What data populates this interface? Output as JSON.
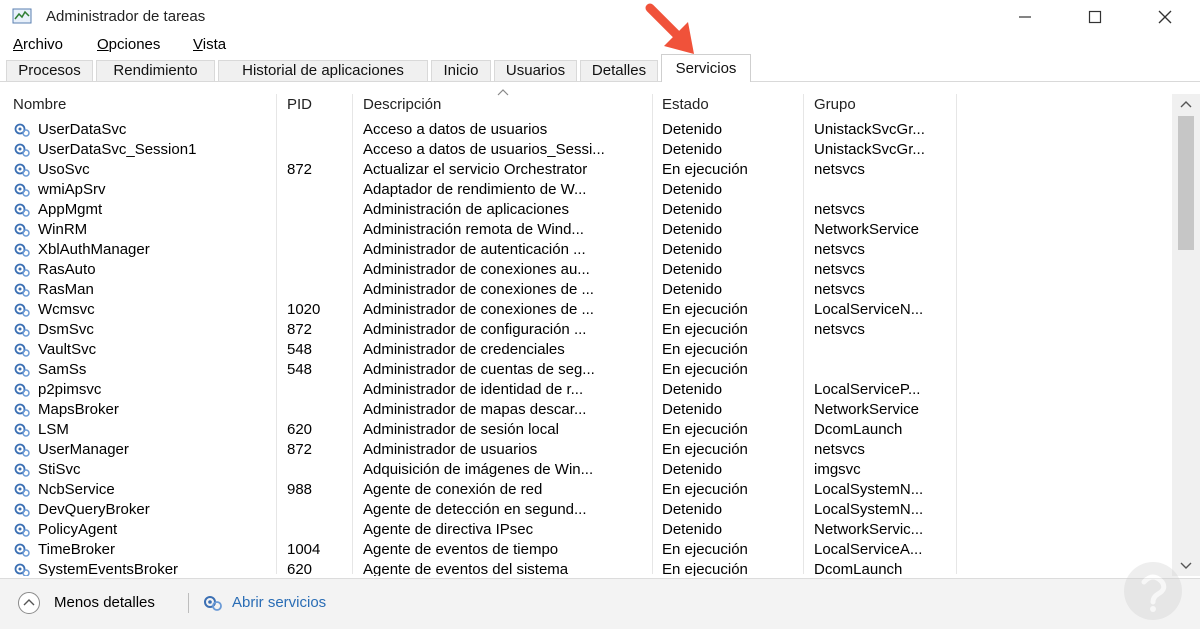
{
  "window": {
    "title": "Administrador de tareas"
  },
  "menu": {
    "archivo": "Archivo",
    "opciones": "Opciones",
    "vista": "Vista"
  },
  "tabs": [
    {
      "label": "Procesos"
    },
    {
      "label": "Rendimiento"
    },
    {
      "label": "Historial de aplicaciones"
    },
    {
      "label": "Inicio"
    },
    {
      "label": "Usuarios"
    },
    {
      "label": "Detalles"
    },
    {
      "label": "Servicios",
      "active": true
    }
  ],
  "columns": {
    "name": "Nombre",
    "pid": "PID",
    "desc": "Descripción",
    "state": "Estado",
    "group": "Grupo"
  },
  "rows": [
    {
      "name": "UserDataSvc",
      "pid": "",
      "desc": "Acceso a datos de usuarios",
      "state": "Detenido",
      "group": "UnistackSvcGr..."
    },
    {
      "name": "UserDataSvc_Session1",
      "pid": "",
      "desc": "Acceso a datos de usuarios_Sessi...",
      "state": "Detenido",
      "group": "UnistackSvcGr..."
    },
    {
      "name": "UsoSvc",
      "pid": "872",
      "desc": "Actualizar el servicio Orchestrator",
      "state": "En ejecución",
      "group": "netsvcs"
    },
    {
      "name": "wmiApSrv",
      "pid": "",
      "desc": "Adaptador de rendimiento de W...",
      "state": "Detenido",
      "group": ""
    },
    {
      "name": "AppMgmt",
      "pid": "",
      "desc": "Administración de aplicaciones",
      "state": "Detenido",
      "group": "netsvcs"
    },
    {
      "name": "WinRM",
      "pid": "",
      "desc": "Administración remota de Wind...",
      "state": "Detenido",
      "group": "NetworkService"
    },
    {
      "name": "XblAuthManager",
      "pid": "",
      "desc": "Administrador de autenticación ...",
      "state": "Detenido",
      "group": "netsvcs"
    },
    {
      "name": "RasAuto",
      "pid": "",
      "desc": "Administrador de conexiones au...",
      "state": "Detenido",
      "group": "netsvcs"
    },
    {
      "name": "RasMan",
      "pid": "",
      "desc": "Administrador de conexiones de ...",
      "state": "Detenido",
      "group": "netsvcs"
    },
    {
      "name": "Wcmsvc",
      "pid": "1020",
      "desc": "Administrador de conexiones de ...",
      "state": "En ejecución",
      "group": "LocalServiceN..."
    },
    {
      "name": "DsmSvc",
      "pid": "872",
      "desc": "Administrador de configuración ...",
      "state": "En ejecución",
      "group": "netsvcs"
    },
    {
      "name": "VaultSvc",
      "pid": "548",
      "desc": "Administrador de credenciales",
      "state": "En ejecución",
      "group": ""
    },
    {
      "name": "SamSs",
      "pid": "548",
      "desc": "Administrador de cuentas de seg...",
      "state": "En ejecución",
      "group": ""
    },
    {
      "name": "p2pimsvc",
      "pid": "",
      "desc": "Administrador de identidad de r...",
      "state": "Detenido",
      "group": "LocalServiceP..."
    },
    {
      "name": "MapsBroker",
      "pid": "",
      "desc": "Administrador de mapas descar...",
      "state": "Detenido",
      "group": "NetworkService"
    },
    {
      "name": "LSM",
      "pid": "620",
      "desc": "Administrador de sesión local",
      "state": "En ejecución",
      "group": "DcomLaunch"
    },
    {
      "name": "UserManager",
      "pid": "872",
      "desc": "Administrador de usuarios",
      "state": "En ejecución",
      "group": "netsvcs"
    },
    {
      "name": "StiSvc",
      "pid": "",
      "desc": "Adquisición de imágenes de Win...",
      "state": "Detenido",
      "group": "imgsvc"
    },
    {
      "name": "NcbService",
      "pid": "988",
      "desc": "Agente de conexión de red",
      "state": "En ejecución",
      "group": "LocalSystemN..."
    },
    {
      "name": "DevQueryBroker",
      "pid": "",
      "desc": "Agente de detección en segund...",
      "state": "Detenido",
      "group": "LocalSystemN..."
    },
    {
      "name": "PolicyAgent",
      "pid": "",
      "desc": "Agente de directiva IPsec",
      "state": "Detenido",
      "group": "NetworkServic..."
    },
    {
      "name": "TimeBroker",
      "pid": "1004",
      "desc": "Agente de eventos de tiempo",
      "state": "En ejecución",
      "group": "LocalServiceA..."
    },
    {
      "name": "SystemEventsBroker",
      "pid": "620",
      "desc": "Agente de eventos del sistema",
      "state": "En ejecución",
      "group": "DcomLaunch"
    }
  ],
  "footer": {
    "less_details": "Menos detalles",
    "open_services": "Abrir servicios"
  },
  "colors": {
    "accent_arrow": "#f0523a",
    "link": "#2a6db5",
    "service_icon": "#3b6fb3"
  },
  "icons": {
    "app": "task-manager-icon",
    "service": "gear-icon",
    "less": "chevron-up-icon",
    "open_services": "services-icon",
    "watermark": "solvetic-logo-icon"
  }
}
